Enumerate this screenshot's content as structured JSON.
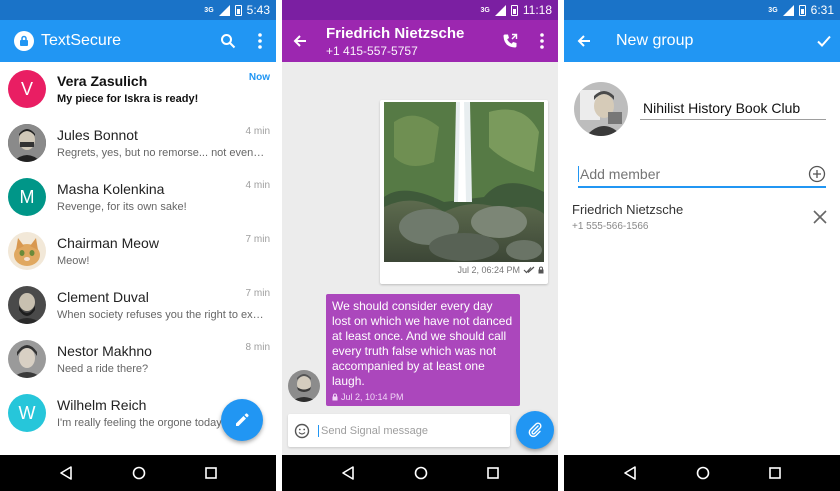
{
  "screens": {
    "conversations": {
      "status_time": "5:43",
      "network": "3G",
      "app_title": "TextSecure",
      "conversations": [
        {
          "name": "Vera Zasulich",
          "snippet": "My piece for Iskra is ready!",
          "time": "Now",
          "initial": "V",
          "avatar_color": "#e91e63",
          "unread": true
        },
        {
          "name": "Jules Bonnot",
          "snippet": "Regrets, yes, but no remorse... not even a glimmer",
          "time": "4 min",
          "initial": "",
          "avatar_color": "#3e3e3e",
          "unread": false
        },
        {
          "name": "Masha Kolenkina",
          "snippet": "Revenge, for its own sake!",
          "time": "4 min",
          "initial": "M",
          "avatar_color": "#009688",
          "unread": false
        },
        {
          "name": "Chairman Meow",
          "snippet": "Meow!",
          "time": "7 min",
          "initial": "",
          "avatar_color": "#d8a96a",
          "unread": false
        },
        {
          "name": "Clement Duval",
          "snippet": "When society refuses you the right to exist, you...",
          "time": "7 min",
          "initial": "",
          "avatar_color": "#555555",
          "unread": false
        },
        {
          "name": "Nestor Makhno",
          "snippet": "Need a ride there?",
          "time": "8 min",
          "initial": "",
          "avatar_color": "#6d6d6d",
          "unread": false
        },
        {
          "name": "Wilhelm Reich",
          "snippet": "I'm really feeling the orgone today!",
          "time": "",
          "initial": "W",
          "avatar_color": "#26c6da",
          "unread": false
        }
      ]
    },
    "conversation": {
      "status_time": "11:18",
      "network": "3G",
      "contact_name": "Friedrich Nietzsche",
      "contact_phone": "+1 415-557-5757",
      "outgoing_time": "Jul 2, 06:24 PM",
      "incoming_text": "We should consider every day lost on which we have not danced at least once. And we should call every truth false which was not accompanied by at least one laugh.",
      "incoming_time": "Jul 2, 10:14 PM",
      "composer_placeholder": "Send Signal message"
    },
    "new_group": {
      "status_time": "6:31",
      "network": "3G",
      "title": "New group",
      "group_name": "Nihilist History Book Club",
      "add_member_placeholder": "Add member",
      "member_name": "Friedrich Nietzsche",
      "member_phone": "+1 555-566-1566"
    }
  },
  "colors": {
    "blue_primary": "#2196f3",
    "blue_dark": "#1a73c8",
    "purple_primary": "#9c27b0",
    "purple_dark": "#7b1fa2",
    "purple_bubble": "#ab47bc"
  }
}
